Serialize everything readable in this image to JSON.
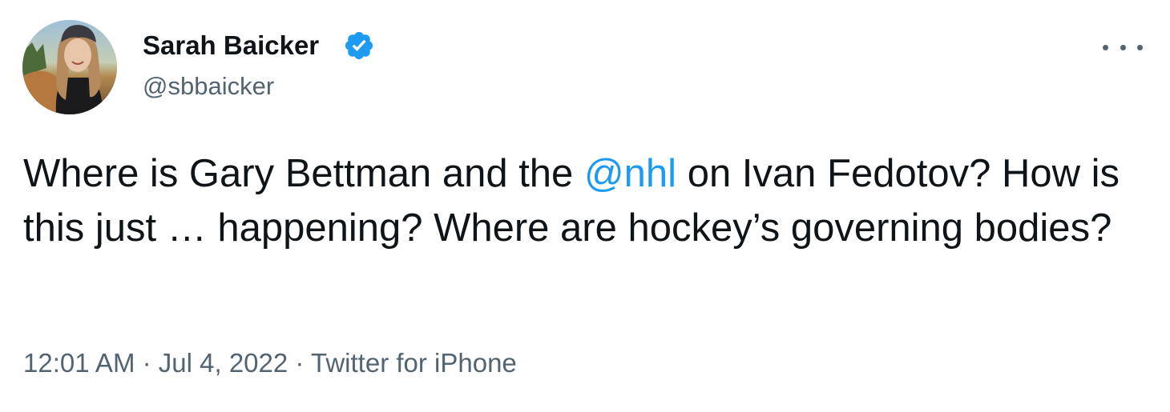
{
  "author": {
    "name": "Sarah Baicker",
    "handle": "@sbbaicker",
    "verified": true,
    "avatar_icon": "profile-photo"
  },
  "tweet": {
    "text_before": "Where is Gary Bettman and the ",
    "mention": "@nhl",
    "text_after": " on Ivan Fedotov? How is this just … happening? Where are hockey’s governing bodies?"
  },
  "meta": {
    "time": "12:01 AM",
    "separator": "·",
    "date": "Jul 4, 2022",
    "source": "Twitter for iPhone"
  },
  "icons": {
    "more": "more-options-icon",
    "verified": "verified-badge-icon"
  },
  "colors": {
    "accent": "#1d9bf0",
    "text_primary": "#0f1419",
    "text_secondary": "#536471"
  }
}
